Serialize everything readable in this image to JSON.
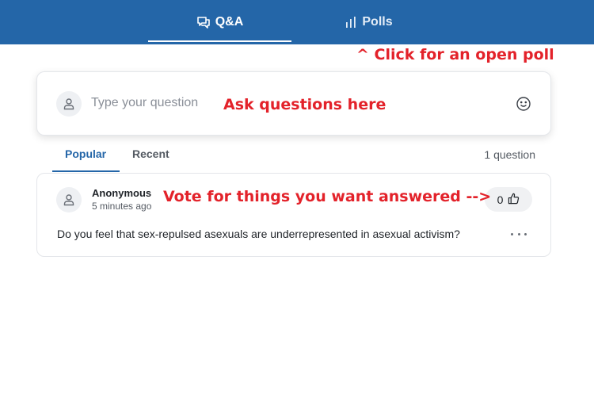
{
  "tabs": [
    {
      "label": "Q&A",
      "icon": "chat-bubbles-icon",
      "active": true
    },
    {
      "label": "Polls",
      "icon": "bar-chart-icon",
      "active": false
    }
  ],
  "annotations": {
    "poll": "^ Click for an open poll",
    "ask": "Ask questions here",
    "vote": "Vote for things you want answered -->"
  },
  "ask": {
    "placeholder": "Type your question",
    "avatar_icon": "user-icon",
    "emoji_icon": "smiley-icon"
  },
  "filters": {
    "popular": "Popular",
    "recent": "Recent",
    "active": "Popular",
    "count": "1 question"
  },
  "questions": [
    {
      "author": "Anonymous",
      "time": "5 minutes ago",
      "votes": "0",
      "text": "Do you feel that sex-repulsed asexuals are underrepresented in asexual activism?"
    }
  ],
  "colors": {
    "brand": "#2466a8",
    "annotation": "#e3222a"
  }
}
